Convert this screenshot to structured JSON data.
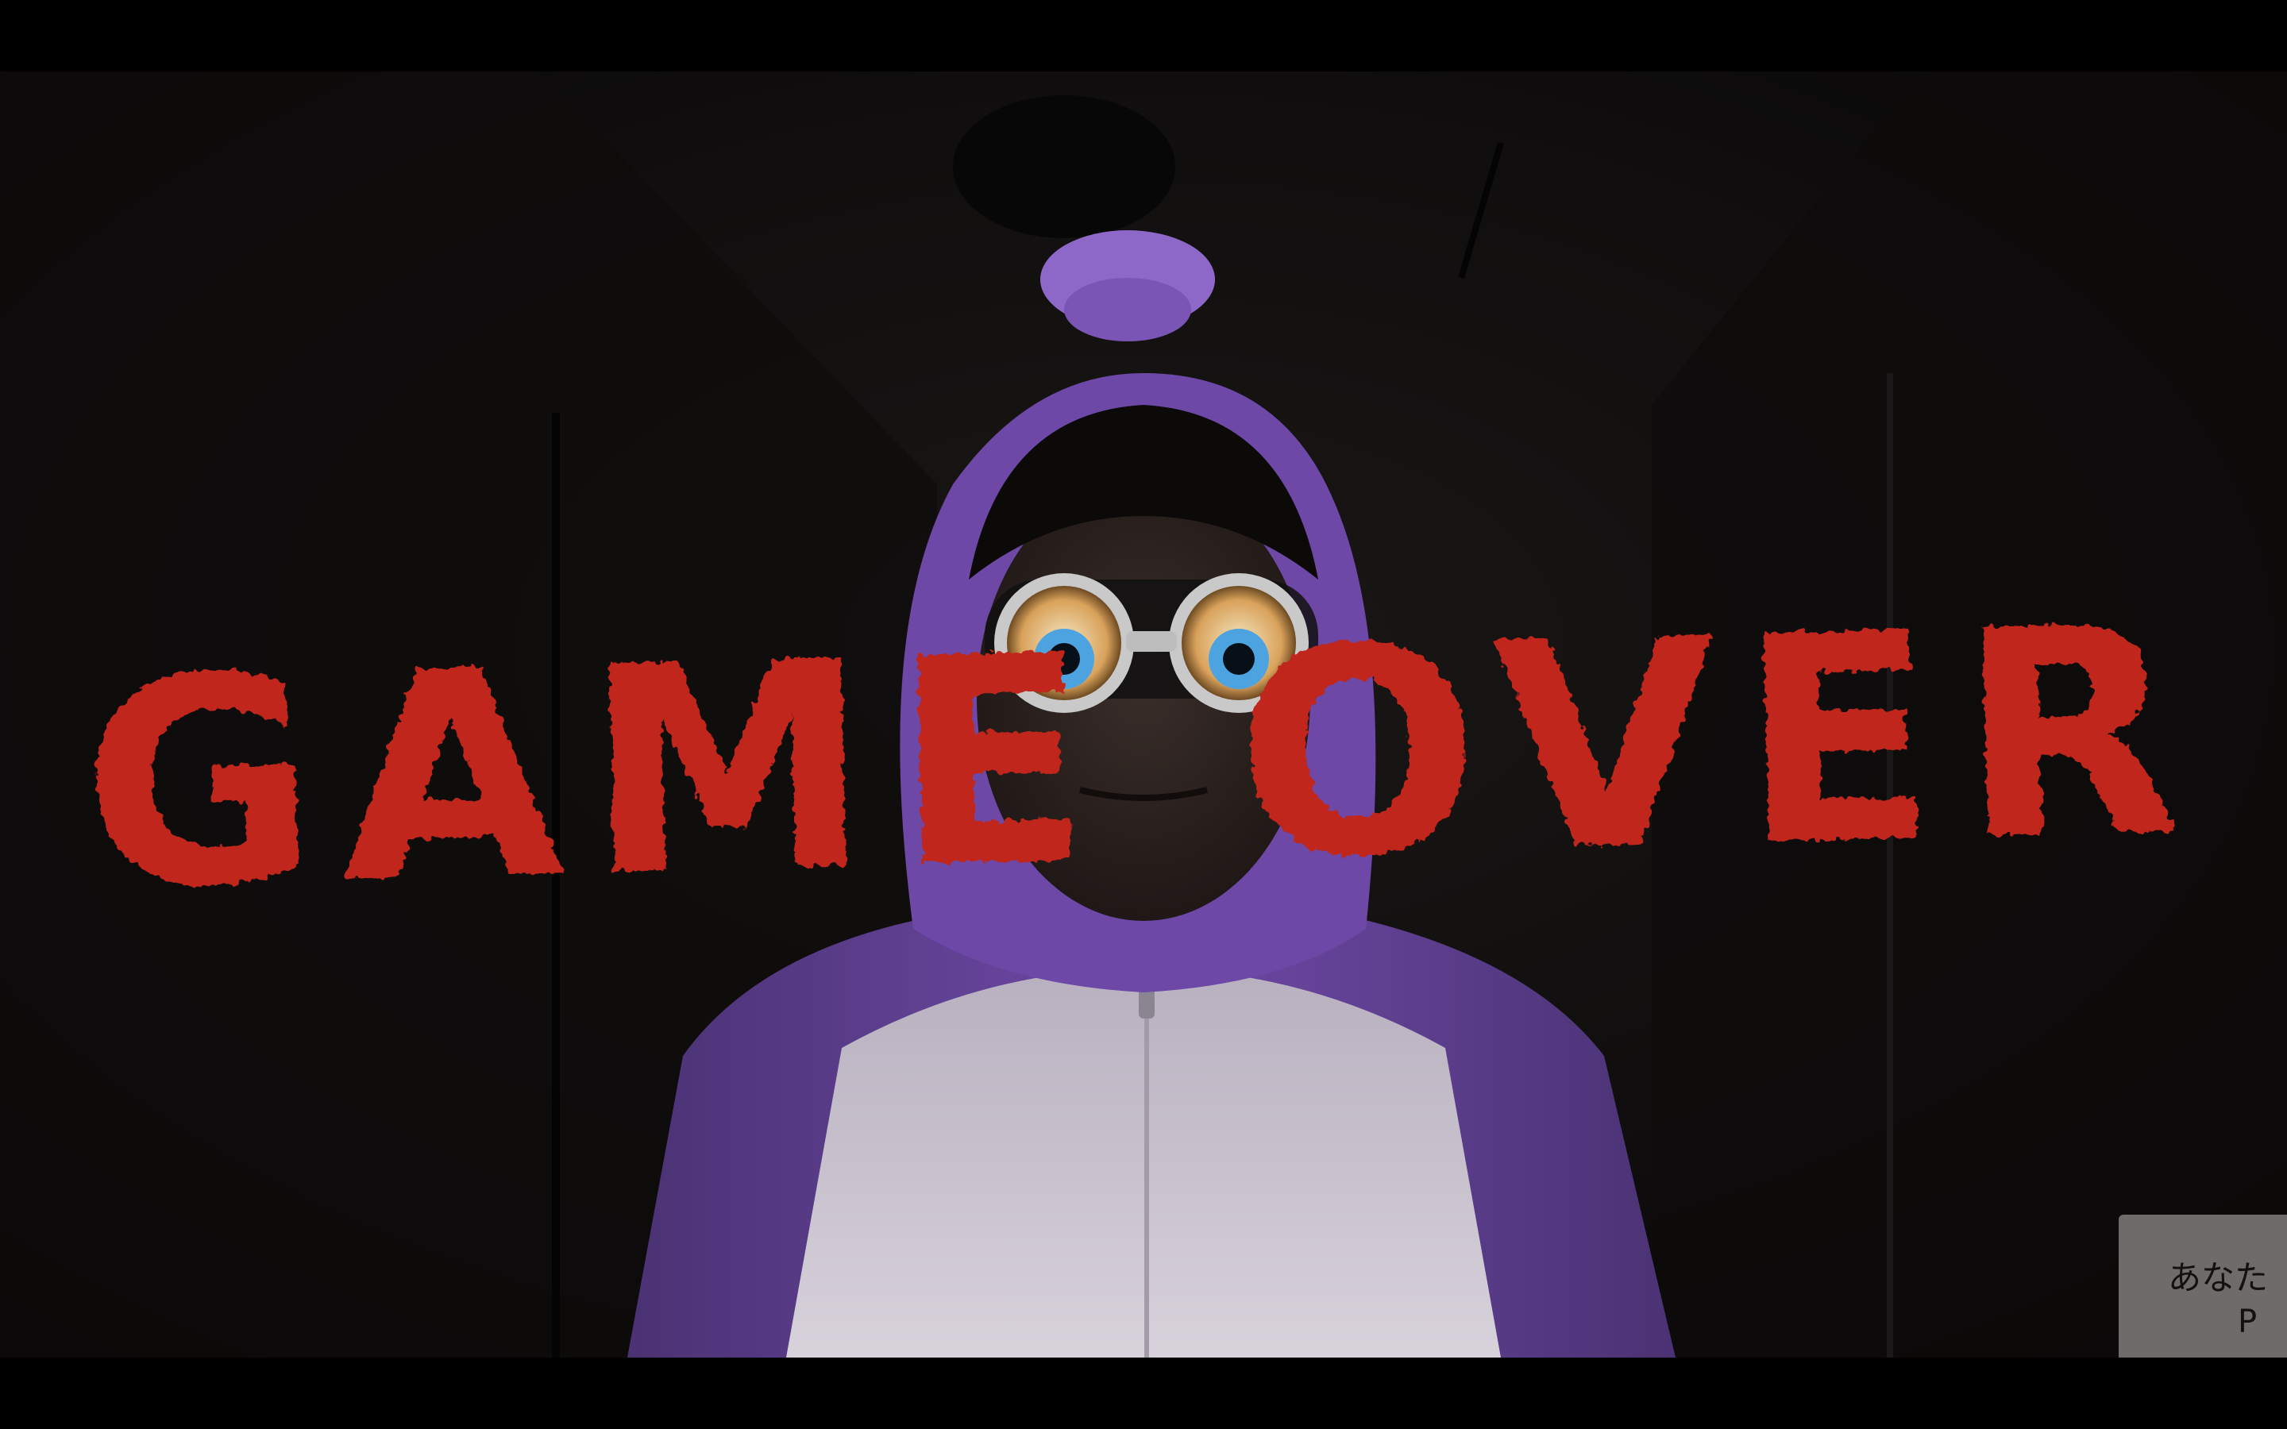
{
  "screen": {
    "title_text": "GAME OVER",
    "title_color": "#c0261b",
    "background_color": "#0b0a0a",
    "letterbox_color": "#000000"
  },
  "character": {
    "costume_color": "#7a52b8",
    "belly_color": "#ddd8e0",
    "eye_iris_color": "#4da3e0",
    "accessory": "googly-eye-goggles"
  },
  "wall_sign": {
    "line1": "あなた",
    "line2": "P"
  }
}
